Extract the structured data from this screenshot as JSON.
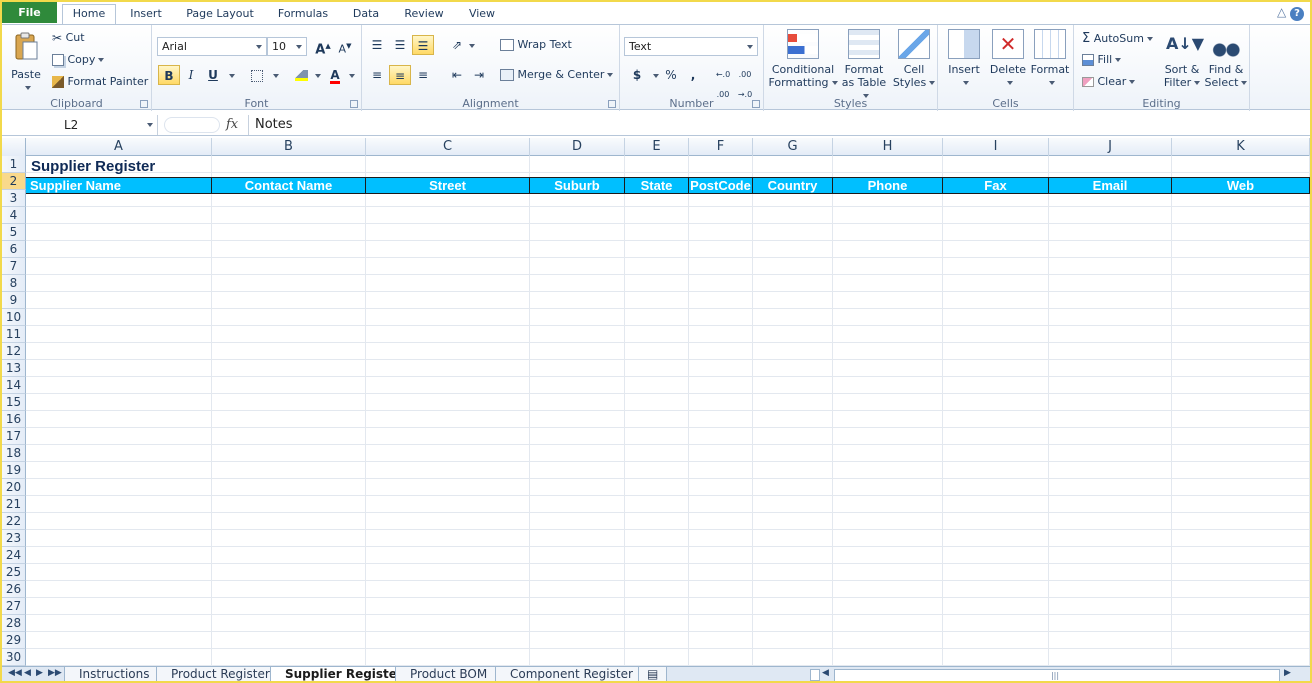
{
  "ribbon_tabs": [
    "File",
    "Home",
    "Insert",
    "Page Layout",
    "Formulas",
    "Data",
    "Review",
    "View"
  ],
  "ribbon": {
    "clipboard": {
      "paste": "Paste",
      "cut": "Cut",
      "copy": "Copy",
      "format_painter": "Format Painter",
      "label": "Clipboard"
    },
    "font": {
      "name": "Arial",
      "size": "10",
      "bold": "B",
      "italic": "I",
      "underline": "U",
      "label": "Font"
    },
    "alignment": {
      "wrap_text": "Wrap Text",
      "merge_center": "Merge & Center",
      "label": "Alignment"
    },
    "number": {
      "format": "Text",
      "currency": "$",
      "percent": "%",
      "comma": ",",
      "inc_dec": "←.0 .00",
      "dec_dec": ".00 →.0",
      "label": "Number"
    },
    "styles": {
      "conditional": "Conditional",
      "conditional2": "Formatting",
      "format_as": "Format",
      "format_as2": "as Table",
      "cell": "Cell",
      "cell2": "Styles",
      "label": "Styles"
    },
    "cells": {
      "insert": "Insert",
      "delete": "Delete",
      "format": "Format",
      "label": "Cells"
    },
    "editing": {
      "autosum": "AutoSum",
      "fill": "Fill",
      "clear": "Clear",
      "sort": "Sort &",
      "sort2": "Filter",
      "find": "Find &",
      "find2": "Select",
      "label": "Editing"
    }
  },
  "formula_bar": {
    "cell_ref": "L2",
    "fx": "fx",
    "content": "Notes"
  },
  "columns": [
    "A",
    "B",
    "C",
    "D",
    "E",
    "F",
    "G",
    "H",
    "I",
    "J",
    "K"
  ],
  "rows": [
    "1",
    "2",
    "3",
    "4",
    "5",
    "6",
    "7",
    "8",
    "9",
    "10",
    "11",
    "12",
    "13",
    "14",
    "15",
    "16",
    "17",
    "18",
    "19",
    "20",
    "21",
    "22",
    "23",
    "24",
    "25",
    "26",
    "27",
    "28",
    "29",
    "30"
  ],
  "sheet": {
    "title": "Supplier Register",
    "headers": [
      "Supplier Name",
      "Contact Name",
      "Street",
      "Suburb",
      "State",
      "PostCode",
      "Country",
      "Phone",
      "Fax",
      "Email",
      "Web"
    ]
  },
  "sheet_tabs": [
    "Instructions",
    "Product Register",
    "Supplier Register",
    "Product BOM",
    "Component Register"
  ],
  "active_sheet": "Supplier Register",
  "colors": {
    "header_fill": "#00bfff",
    "file_tab": "#2f8a3b",
    "title_text": "#0f2a56"
  }
}
